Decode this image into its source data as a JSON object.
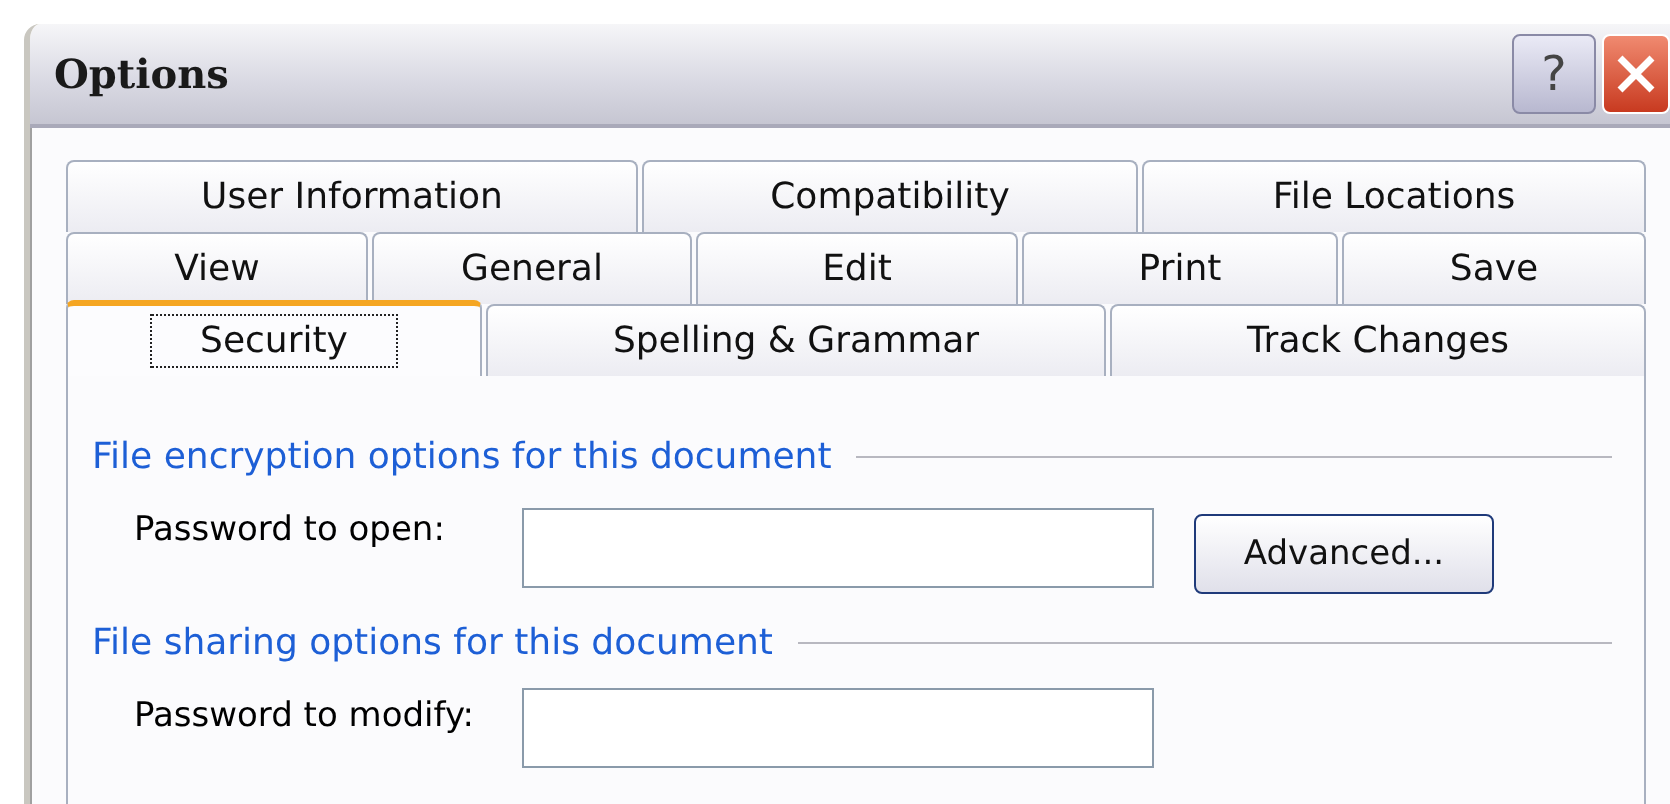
{
  "window": {
    "title": "Options"
  },
  "title_buttons": [
    {
      "kind": "help",
      "label": "?"
    },
    {
      "kind": "close"
    }
  ],
  "tab_rows": [
    [
      {
        "label": "User Information",
        "selected": false
      },
      {
        "label": "Compatibility",
        "selected": false
      },
      {
        "label": "File Locations",
        "selected": false
      }
    ],
    [
      {
        "label": "View",
        "selected": false
      },
      {
        "label": "General",
        "selected": false
      },
      {
        "label": "Edit",
        "selected": false
      },
      {
        "label": "Print",
        "selected": false
      },
      {
        "label": "Save",
        "selected": false
      }
    ],
    [
      {
        "label": "Security",
        "selected": true
      },
      {
        "label": "Spelling & Grammar",
        "selected": false
      },
      {
        "label": "Track Changes",
        "selected": false
      }
    ]
  ],
  "groups": [
    {
      "heading": "File encryption options for this document",
      "field": {
        "label": "Password to open:"
      },
      "button": "Advanced..."
    },
    {
      "heading": "File sharing options for this document",
      "field": {
        "label": "Password to modify:"
      }
    }
  ]
}
